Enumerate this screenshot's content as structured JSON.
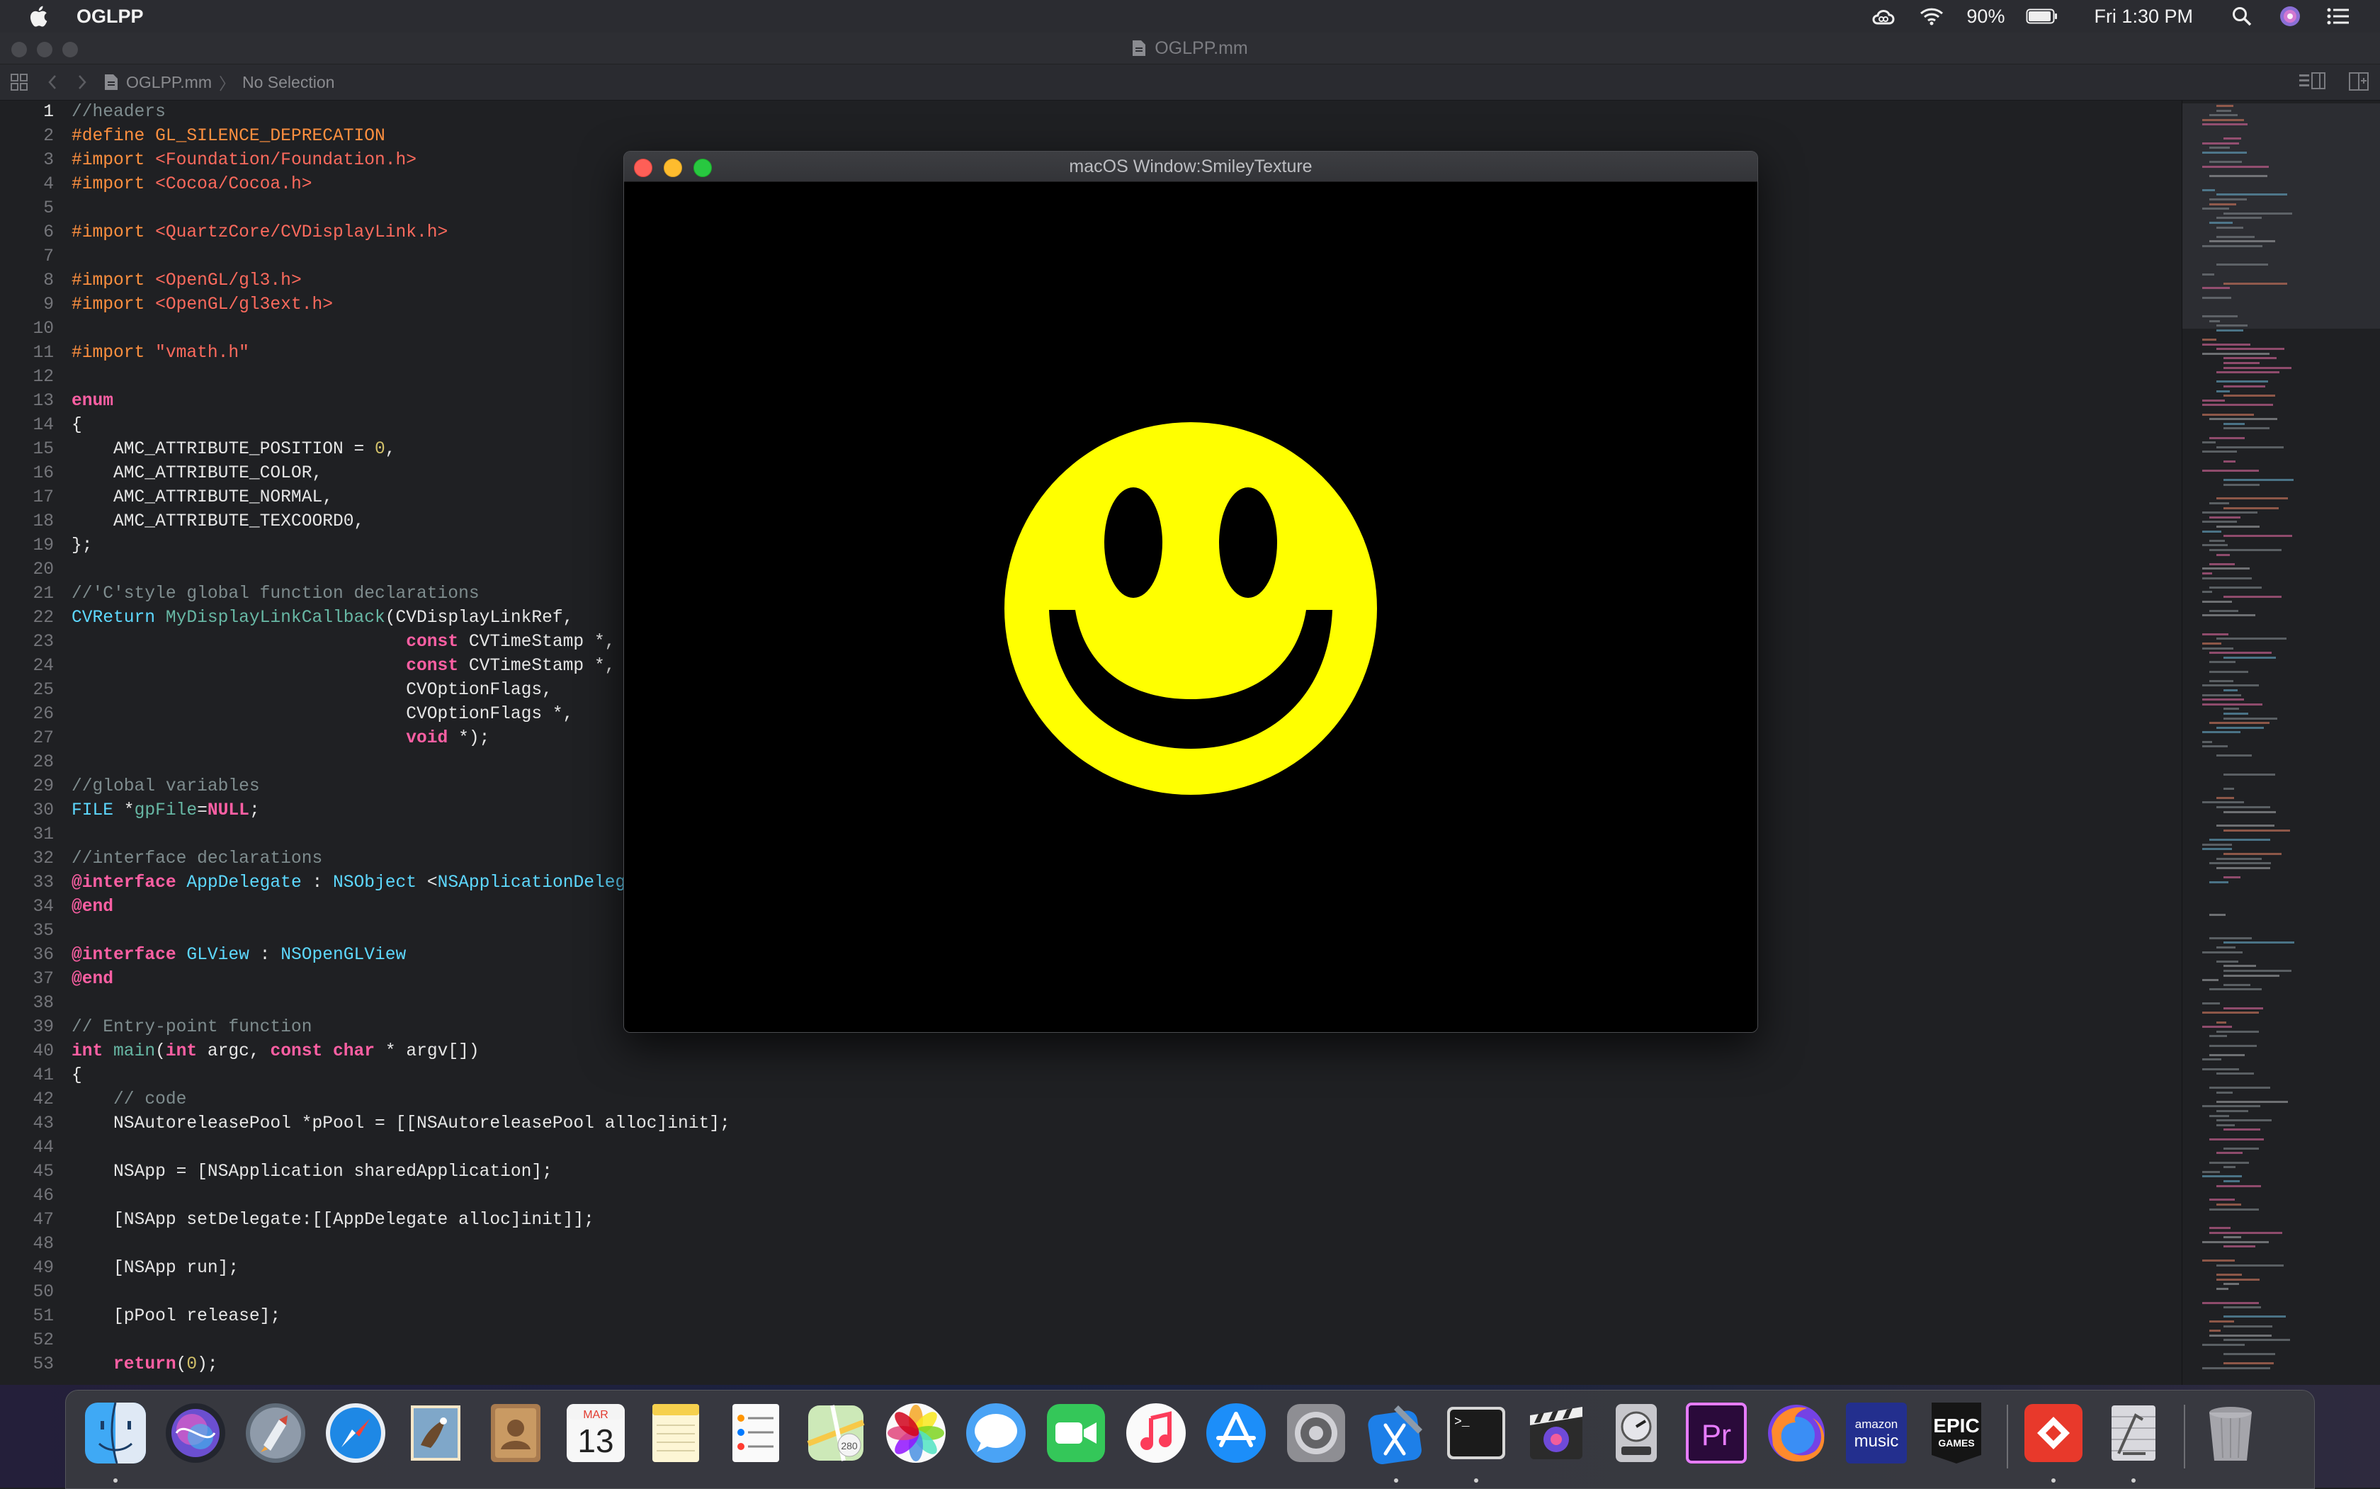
{
  "menubar": {
    "app_name": "OGLPP",
    "battery": "90%",
    "clock": "Fri 1:30 PM"
  },
  "xcode": {
    "title": "OGLPP.mm",
    "breadcrumb_file": "OGLPP.mm",
    "breadcrumb_selection": "No Selection"
  },
  "editor": {
    "current_line": 1,
    "lines": [
      {
        "n": "1",
        "spans": [
          [
            "cm",
            "//headers"
          ]
        ]
      },
      {
        "n": "2",
        "spans": [
          [
            "pp",
            "#define GL_SILENCE_DEPRECATION"
          ]
        ]
      },
      {
        "n": "3",
        "spans": [
          [
            "pp",
            "#import "
          ],
          [
            "str",
            "<Foundation/Foundation.h>"
          ]
        ]
      },
      {
        "n": "4",
        "spans": [
          [
            "pp",
            "#import "
          ],
          [
            "str",
            "<Cocoa/Cocoa.h>"
          ]
        ]
      },
      {
        "n": "5",
        "spans": []
      },
      {
        "n": "6",
        "spans": [
          [
            "pp",
            "#import "
          ],
          [
            "str",
            "<QuartzCore/CVDisplayLink.h>"
          ]
        ]
      },
      {
        "n": "7",
        "spans": []
      },
      {
        "n": "8",
        "spans": [
          [
            "pp",
            "#import "
          ],
          [
            "str",
            "<OpenGL/gl3.h>"
          ]
        ]
      },
      {
        "n": "9",
        "spans": [
          [
            "pp",
            "#import "
          ],
          [
            "str",
            "<OpenGL/gl3ext.h>"
          ]
        ]
      },
      {
        "n": "10",
        "spans": []
      },
      {
        "n": "11",
        "spans": [
          [
            "pp",
            "#import "
          ],
          [
            "str",
            "\"vmath.h\""
          ]
        ]
      },
      {
        "n": "12",
        "spans": []
      },
      {
        "n": "13",
        "spans": [
          [
            "kw",
            "enum"
          ]
        ]
      },
      {
        "n": "14",
        "spans": [
          [
            "pl",
            "{"
          ]
        ]
      },
      {
        "n": "15",
        "spans": [
          [
            "pl",
            "    AMC_ATTRIBUTE_POSITION = "
          ],
          [
            "num",
            "0"
          ],
          [
            "pl",
            ","
          ]
        ]
      },
      {
        "n": "16",
        "spans": [
          [
            "pl",
            "    AMC_ATTRIBUTE_COLOR,"
          ]
        ]
      },
      {
        "n": "17",
        "spans": [
          [
            "pl",
            "    AMC_ATTRIBUTE_NORMAL,"
          ]
        ]
      },
      {
        "n": "18",
        "spans": [
          [
            "pl",
            "    AMC_ATTRIBUTE_TEXCOORD0,"
          ]
        ]
      },
      {
        "n": "19",
        "spans": [
          [
            "pl",
            "};"
          ]
        ]
      },
      {
        "n": "20",
        "spans": []
      },
      {
        "n": "21",
        "spans": [
          [
            "cm",
            "//'C'style global function declarations"
          ]
        ]
      },
      {
        "n": "22",
        "spans": [
          [
            "ty",
            "CVReturn "
          ],
          [
            "fn",
            "MyDisplayLinkCallback"
          ],
          [
            "pl",
            "(CVDisplayLinkRef,"
          ]
        ]
      },
      {
        "n": "23",
        "spans": [
          [
            "pl",
            "                                "
          ],
          [
            "kw",
            "const"
          ],
          [
            "pl",
            " CVTimeStamp *,"
          ]
        ]
      },
      {
        "n": "24",
        "spans": [
          [
            "pl",
            "                                "
          ],
          [
            "kw",
            "const"
          ],
          [
            "pl",
            " CVTimeStamp *,"
          ]
        ]
      },
      {
        "n": "25",
        "spans": [
          [
            "pl",
            "                                CVOptionFlags,"
          ]
        ]
      },
      {
        "n": "26",
        "spans": [
          [
            "pl",
            "                                CVOptionFlags *,"
          ]
        ]
      },
      {
        "n": "27",
        "spans": [
          [
            "pl",
            "                                "
          ],
          [
            "kw",
            "void"
          ],
          [
            "pl",
            " *);"
          ]
        ]
      },
      {
        "n": "28",
        "spans": []
      },
      {
        "n": "29",
        "spans": [
          [
            "cm",
            "//global variables"
          ]
        ]
      },
      {
        "n": "30",
        "spans": [
          [
            "ty",
            "FILE"
          ],
          [
            "pl",
            " *"
          ],
          [
            "fn",
            "gpFile"
          ],
          [
            "pl",
            "="
          ],
          [
            "kw",
            "NULL"
          ],
          [
            "pl",
            ";"
          ]
        ]
      },
      {
        "n": "31",
        "spans": []
      },
      {
        "n": "32",
        "spans": [
          [
            "cm",
            "//interface declarations"
          ]
        ]
      },
      {
        "n": "33",
        "spans": [
          [
            "kw",
            "@interface"
          ],
          [
            "pl",
            " "
          ],
          [
            "ty",
            "AppDelegate"
          ],
          [
            "pl",
            " : "
          ],
          [
            "ty",
            "NSObject"
          ],
          [
            "pl",
            " <"
          ],
          [
            "ty",
            "NSApplicationDeleg"
          ]
        ]
      },
      {
        "n": "34",
        "spans": [
          [
            "kw",
            "@end"
          ]
        ]
      },
      {
        "n": "35",
        "spans": []
      },
      {
        "n": "36",
        "spans": [
          [
            "kw",
            "@interface"
          ],
          [
            "pl",
            " "
          ],
          [
            "ty",
            "GLView"
          ],
          [
            "pl",
            " : "
          ],
          [
            "ty",
            "NSOpenGLView"
          ]
        ]
      },
      {
        "n": "37",
        "spans": [
          [
            "kw",
            "@end"
          ]
        ]
      },
      {
        "n": "38",
        "spans": []
      },
      {
        "n": "39",
        "spans": [
          [
            "cm",
            "// Entry-point function"
          ]
        ]
      },
      {
        "n": "40",
        "spans": [
          [
            "kw",
            "int"
          ],
          [
            "pl",
            " "
          ],
          [
            "fn",
            "main"
          ],
          [
            "pl",
            "("
          ],
          [
            "kw",
            "int"
          ],
          [
            "pl",
            " argc, "
          ],
          [
            "kw",
            "const"
          ],
          [
            "pl",
            " "
          ],
          [
            "kw",
            "char"
          ],
          [
            "pl",
            " * argv[])"
          ]
        ]
      },
      {
        "n": "41",
        "spans": [
          [
            "pl",
            "{"
          ]
        ]
      },
      {
        "n": "42",
        "spans": [
          [
            "pl",
            "    "
          ],
          [
            "cm",
            "// code"
          ]
        ]
      },
      {
        "n": "43",
        "spans": [
          [
            "pl",
            "    NSAutoreleasePool *pPool = [[NSAutoreleasePool alloc]init];"
          ]
        ]
      },
      {
        "n": "44",
        "spans": []
      },
      {
        "n": "45",
        "spans": [
          [
            "pl",
            "    NSApp = [NSApplication sharedApplication];"
          ]
        ]
      },
      {
        "n": "46",
        "spans": []
      },
      {
        "n": "47",
        "spans": [
          [
            "pl",
            "    [NSApp setDelegate:[[AppDelegate alloc]init]];"
          ]
        ]
      },
      {
        "n": "48",
        "spans": []
      },
      {
        "n": "49",
        "spans": [
          [
            "pl",
            "    [NSApp run];"
          ]
        ]
      },
      {
        "n": "50",
        "spans": []
      },
      {
        "n": "51",
        "spans": [
          [
            "pl",
            "    [pPool release];"
          ]
        ]
      },
      {
        "n": "52",
        "spans": []
      },
      {
        "n": "53",
        "spans": [
          [
            "pl",
            "    "
          ],
          [
            "kw",
            "return"
          ],
          [
            "pl",
            "("
          ],
          [
            "num",
            "0"
          ],
          [
            "pl",
            ");"
          ]
        ]
      }
    ]
  },
  "gl_window": {
    "title": "macOS Window:SmileyTexture",
    "smiley_color": "#ffff00",
    "background_color": "#000000"
  },
  "dock": {
    "items": [
      {
        "name": "finder",
        "running": true
      },
      {
        "name": "siri",
        "running": false
      },
      {
        "name": "launchpad",
        "running": false
      },
      {
        "name": "safari",
        "running": false
      },
      {
        "name": "mail",
        "running": false
      },
      {
        "name": "contacts",
        "running": false
      },
      {
        "name": "calendar",
        "running": false,
        "month": "MAR",
        "day": "13"
      },
      {
        "name": "notes",
        "running": false
      },
      {
        "name": "reminders",
        "running": false
      },
      {
        "name": "maps",
        "running": false
      },
      {
        "name": "photos",
        "running": false
      },
      {
        "name": "messages",
        "running": false
      },
      {
        "name": "facetime",
        "running": false
      },
      {
        "name": "music",
        "running": false
      },
      {
        "name": "app-store",
        "running": false
      },
      {
        "name": "system-preferences",
        "running": false
      },
      {
        "name": "xcode",
        "running": true
      },
      {
        "name": "terminal",
        "running": true
      },
      {
        "name": "final-cut-pro",
        "running": false
      },
      {
        "name": "compressor",
        "running": false
      },
      {
        "name": "premiere-pro",
        "running": false,
        "label": "Pr"
      },
      {
        "name": "firefox",
        "running": false
      },
      {
        "name": "amazon-music",
        "running": false,
        "label1": "amazon",
        "label2": "music"
      },
      {
        "name": "epic-games",
        "running": false,
        "label1": "EPIC",
        "label2": "GAMES"
      },
      {
        "name": "anydesk",
        "running": true
      },
      {
        "name": "instruments",
        "running": true
      },
      {
        "name": "trash",
        "running": false
      }
    ]
  }
}
